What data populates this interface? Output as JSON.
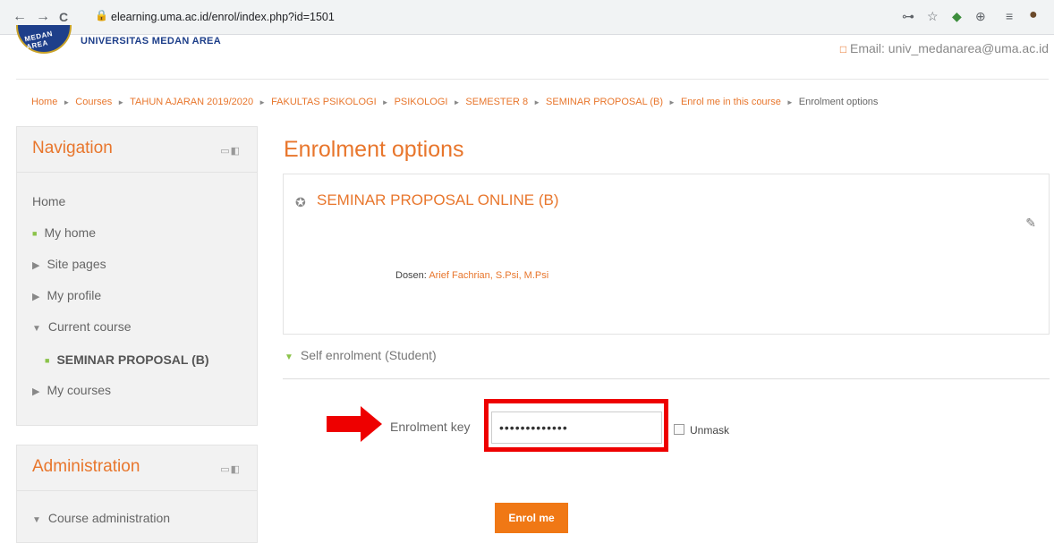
{
  "browser": {
    "url": "elearning.uma.ac.id/enrol/index.php?id=1501",
    "back_icon": "←",
    "forward_icon": "→",
    "reload_icon": "C",
    "lock_icon": "🔒",
    "key_icon": "⊶",
    "star_icon": "☆",
    "ext1_icon": "◆",
    "ext2_icon": "⊕",
    "menu_icon": "≡",
    "avatar_icon": "●"
  },
  "header": {
    "logo_text": "MEDAN AREA",
    "site_name": "UNIVERSITAS MEDAN AREA",
    "email_glyph": "□",
    "email": "Email: univ_medanarea@uma.ac.id"
  },
  "breadcrumb": {
    "separator": "►",
    "items": [
      "Home",
      "Courses",
      "TAHUN AJARAN 2019/2020",
      "FAKULTAS PSIKOLOGI",
      "PSIKOLOGI",
      "SEMESTER 8",
      "SEMINAR PROPOSAL (B)",
      "Enrol me in this course",
      "Enrolment options"
    ]
  },
  "navigation": {
    "title": "Navigation",
    "controls": "▭◧",
    "home": "Home",
    "my_home": "My home",
    "site_pages": "Site pages",
    "my_profile": "My profile",
    "current_course": "Current course",
    "course_short": "SEMINAR PROPOSAL (B)",
    "my_courses": "My courses"
  },
  "administration": {
    "title": "Administration",
    "controls": "▭◧",
    "course_admin": "Course administration"
  },
  "main": {
    "page_title": "Enrolment options",
    "course_name": "SEMINAR PROPOSAL ONLINE (B)",
    "teacher_role": "Dosen:",
    "teacher_name": "Arief Fachrian, S.Psi, M.Psi",
    "self_enrol": "Self enrolment (Student)",
    "key_label": "Enrolment key",
    "key_value": "•••••••••••••",
    "unmask_label": "Unmask",
    "enrol_button": "Enrol me"
  },
  "colors": {
    "accent": "#e8762c",
    "button": "#f07815",
    "highlight": "#e00000",
    "bullet": "#8bc34a"
  }
}
